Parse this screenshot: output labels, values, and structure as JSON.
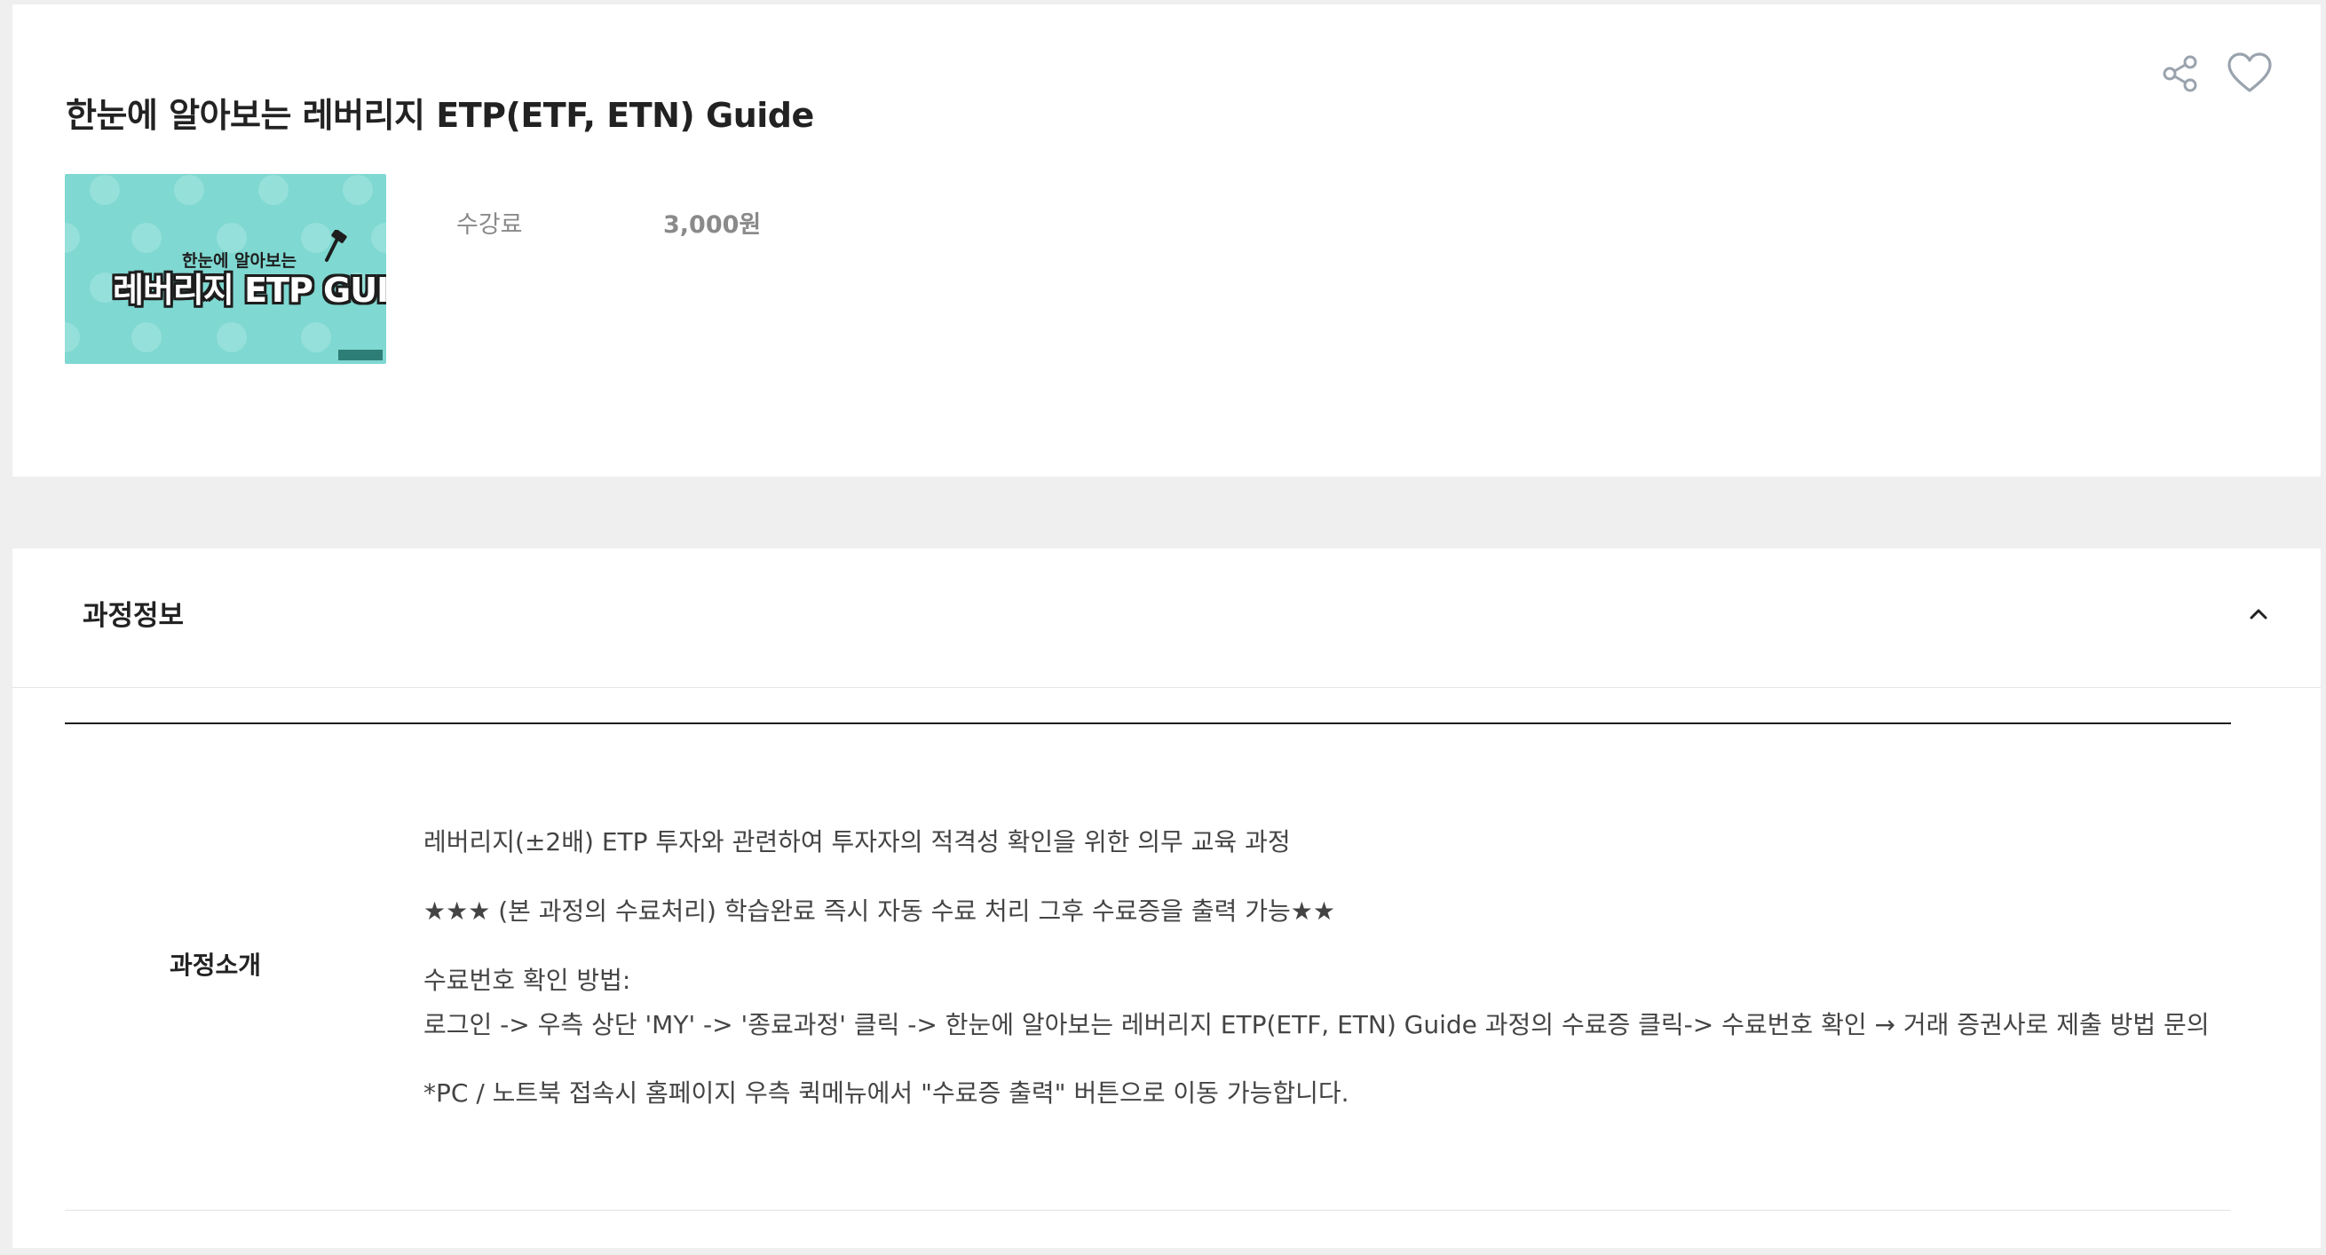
{
  "course": {
    "title": "한눈에 알아보는 레버리지 ETP(ETF, ETN) Guide",
    "fee_label": "수강료",
    "fee_value": "3,000원",
    "thumbnail": {
      "small_text": "한눈에 알아보는",
      "big_text": "레버리지 ETP GUIDE",
      "bg_color": "#7fd8d1"
    }
  },
  "actions": {
    "share_icon": "share-icon",
    "favorite_icon": "heart-icon"
  },
  "course_info": {
    "section_title": "과정정보",
    "toggle_icon": "chevron-up-icon",
    "intro_label": "과정소개",
    "lines": [
      "레버리지(±2배) ETP 투자와 관련하여 투자자의 적격성 확인을 위한 의무 교육 과정",
      "★★★ (본 과정의 수료처리) 학습완료 즉시 자동 수료 처리 그후 수료증을 출력 가능★★",
      "수료번호 확인 방법:",
      "로그인 -> 우측 상단 'MY' -> '종료과정'  클릭 -> 한눈에 알아보는 레버리지 ETP(ETF, ETN) Guide 과정의 수료증 클릭-> 수료번호 확인 → 거래 증권사로 제출 방법 문의",
      "*PC / 노트북 접속시 홈페이지 우측 퀵메뉴에서 \"수료증 출력\" 버튼으로 이동 가능합니다."
    ]
  }
}
